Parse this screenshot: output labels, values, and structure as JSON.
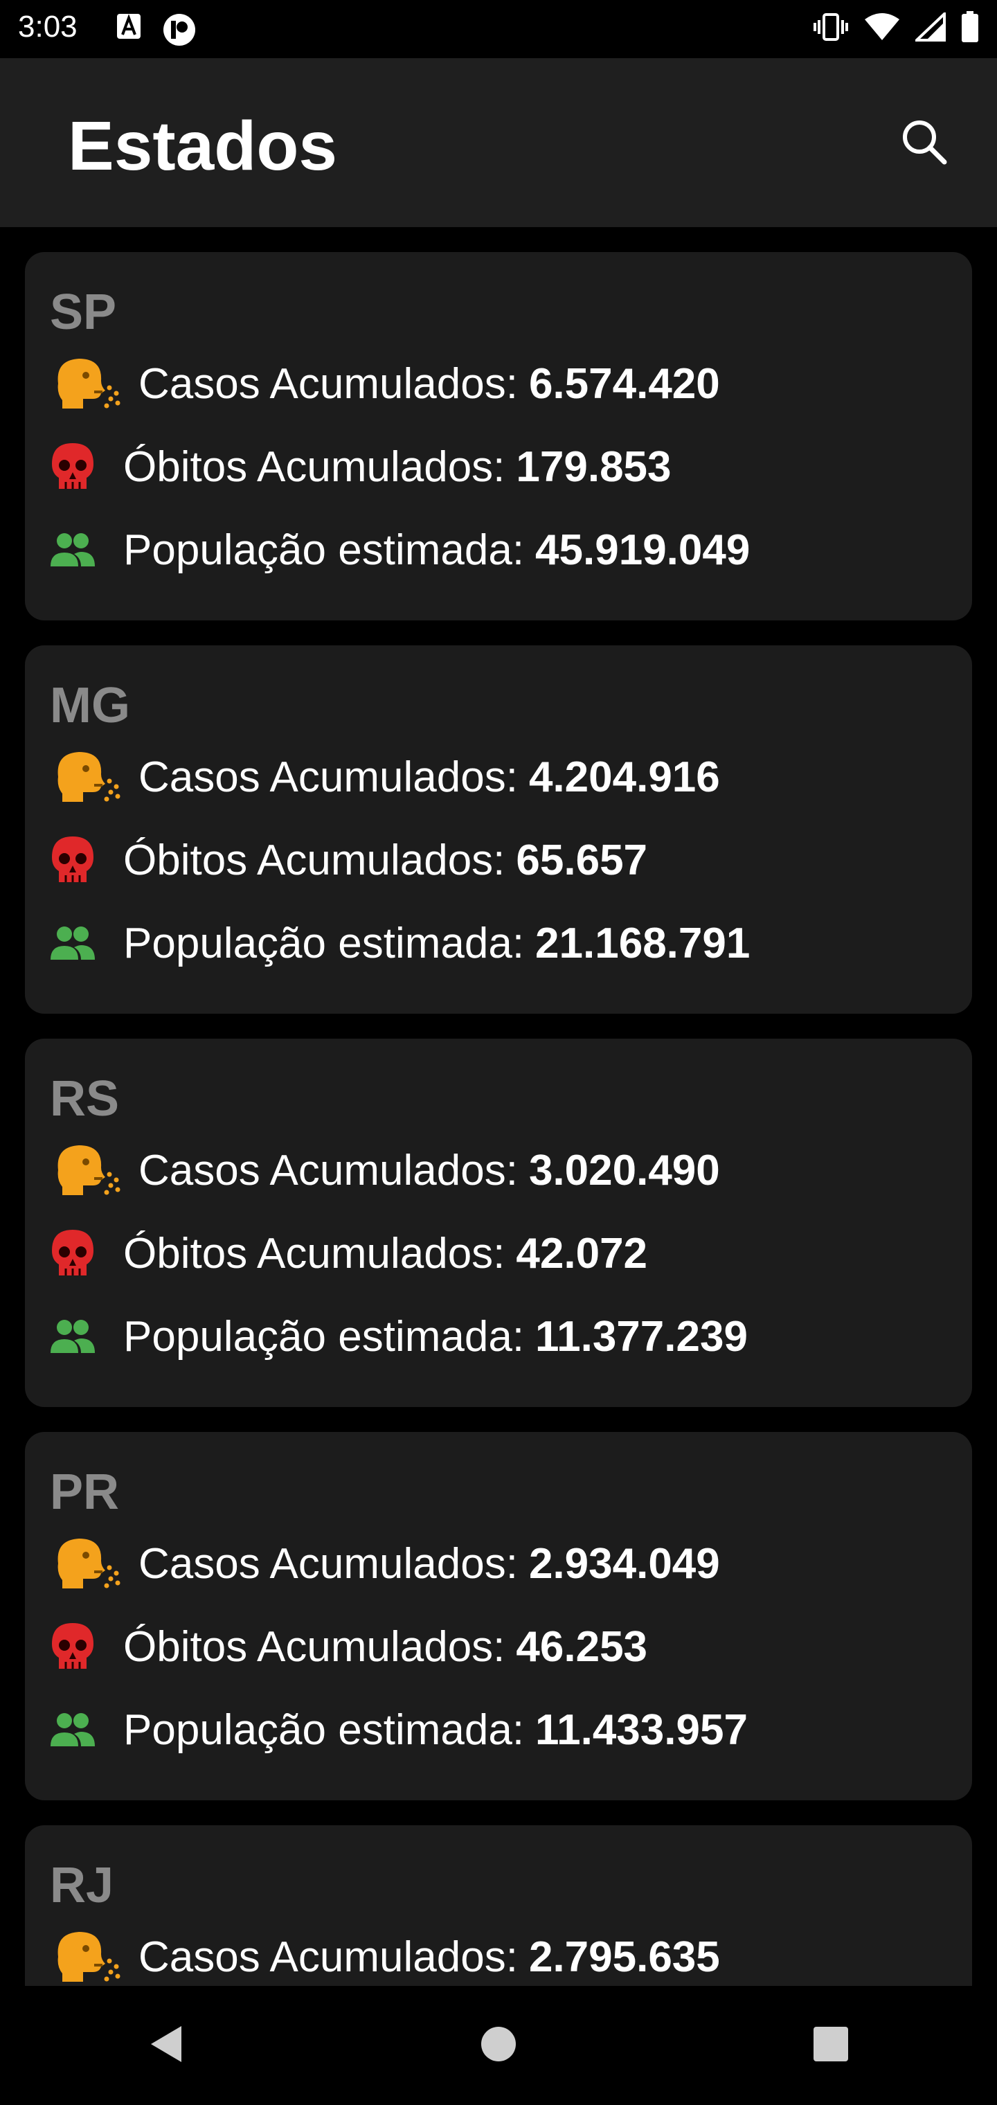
{
  "status_bar": {
    "time": "3:03",
    "left_icons": [
      "a-notification-icon",
      "record-notification-icon"
    ],
    "right_icons": [
      "vibrate-icon",
      "wifi-icon",
      "signal-icon",
      "battery-icon"
    ]
  },
  "app_bar": {
    "title": "Estados",
    "search_icon": "search-icon"
  },
  "labels": {
    "cases": "Casos Acumulados:",
    "deaths": "Óbitos Acumulados:",
    "population": "População estimada:"
  },
  "states": [
    {
      "code": "SP",
      "cases": "6.574.420",
      "deaths": "179.853",
      "population": "45.919.049"
    },
    {
      "code": "MG",
      "cases": "4.204.916",
      "deaths": "65.657",
      "population": "21.168.791"
    },
    {
      "code": "RS",
      "cases": "3.020.490",
      "deaths": "42.072",
      "population": "11.377.239"
    },
    {
      "code": "PR",
      "cases": "2.934.049",
      "deaths": "46.253",
      "population": "11.433.957"
    },
    {
      "code": "RJ",
      "cases": "2.795.635"
    }
  ],
  "colors": {
    "background": "#000000",
    "app_bar": "#1f1f1f",
    "card": "#1c1c1c",
    "state_code": "#8a8a8a",
    "cough_icon": "#f4a21c",
    "skull_icon": "#e0282a",
    "people_icon": "#4caf50"
  },
  "nav_bar": {
    "icons": [
      "back-icon",
      "home-icon",
      "recents-icon"
    ]
  }
}
